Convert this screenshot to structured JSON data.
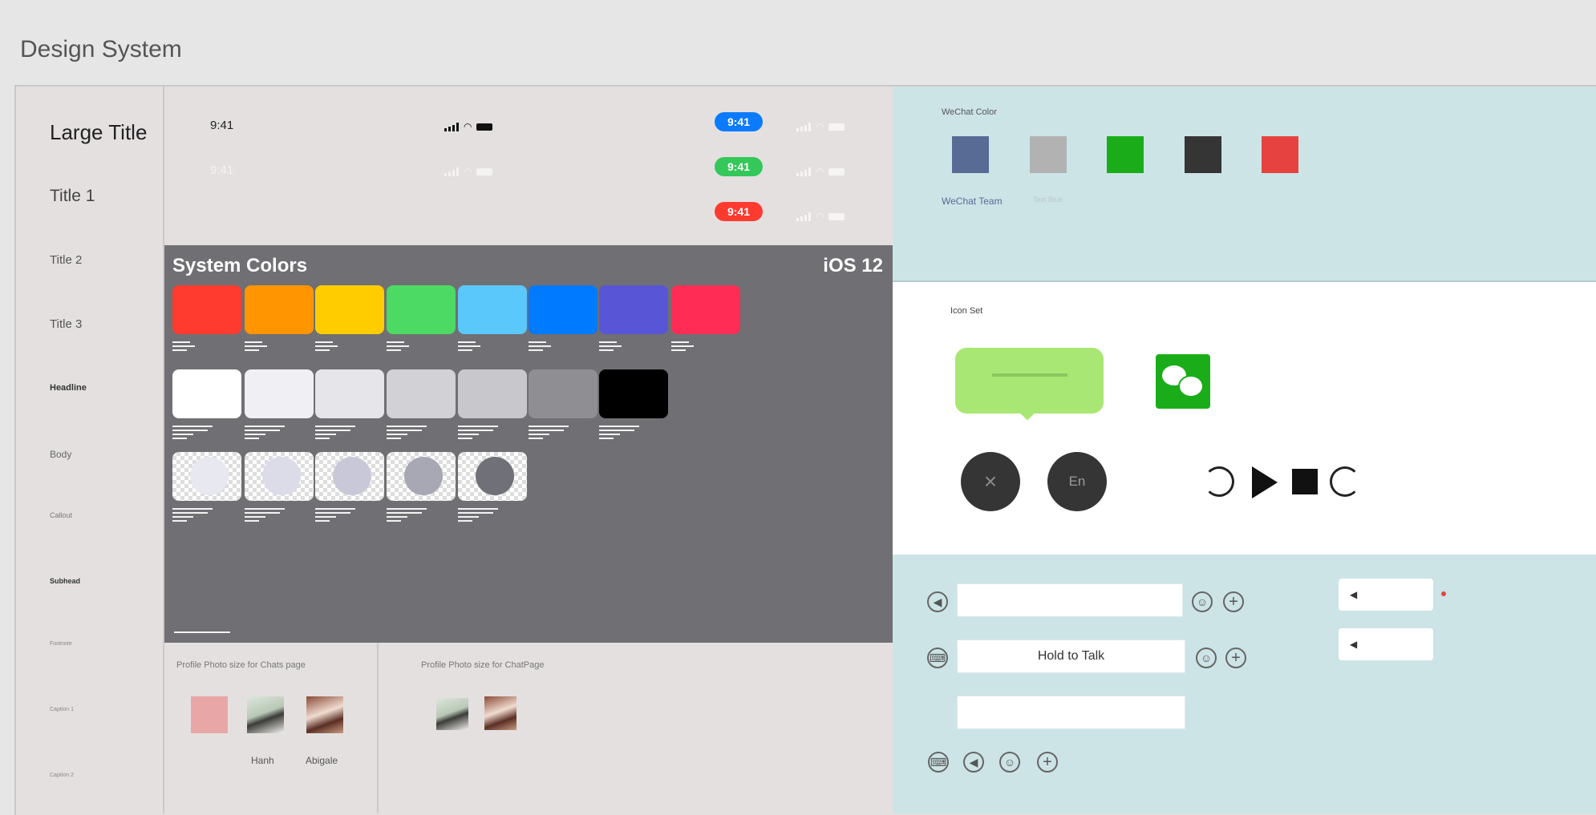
{
  "page": {
    "title": "Design System"
  },
  "typography": [
    {
      "label": "Large Title"
    },
    {
      "label": "Title 1"
    },
    {
      "label": "Title 2"
    },
    {
      "label": "Title 3"
    },
    {
      "label": "Headline"
    },
    {
      "label": "Body"
    },
    {
      "label": "Callout"
    },
    {
      "label": "Subhead"
    },
    {
      "label": "Footnote"
    },
    {
      "label": "Caption 1"
    },
    {
      "label": "Caption 2"
    }
  ],
  "status_bars": {
    "time": "9:41",
    "pills": [
      {
        "label": "9:41",
        "color": "#0a7bff"
      },
      {
        "label": "9:41",
        "color": "#34c759"
      },
      {
        "label": "9:41",
        "color": "#ff3b30"
      }
    ]
  },
  "system_colors": {
    "title": "System Colors",
    "version": "iOS 12",
    "row1": [
      "#ff3b30",
      "#ff9500",
      "#ffcc00",
      "#4cd964",
      "#5ac8fa",
      "#007aff",
      "#5856d6",
      "#ff2d55"
    ],
    "row2": [
      "#ffffff",
      "#efeff4",
      "#e5e5ea",
      "#d1d1d6",
      "#c7c7cc",
      "#8e8e93",
      "#000000"
    ],
    "row3_overlays": [
      "#e8e8f0",
      "#dcdce8",
      "#c8c8d8",
      "#a8a8b4",
      "#707078"
    ]
  },
  "profiles": {
    "chats_label": "Profile Photo  size for Chats page",
    "chat_label": "Profile Photo  size for ChatPage",
    "names": [
      "Hanh",
      "Abigale"
    ]
  },
  "wechat": {
    "color_title": "WeChat Color",
    "colors": [
      "#576b95",
      "#b2b2b2",
      "#1aad19",
      "#353535",
      "#e64340"
    ],
    "team_label": "WeChat Team",
    "text_blue_label": "Text Blue",
    "icon_set_title": "Icon Set",
    "bubble_text": "—————————",
    "close_icon": "×",
    "lang_label": "En"
  },
  "chat_input": {
    "hold_to_talk": "Hold to Talk"
  }
}
